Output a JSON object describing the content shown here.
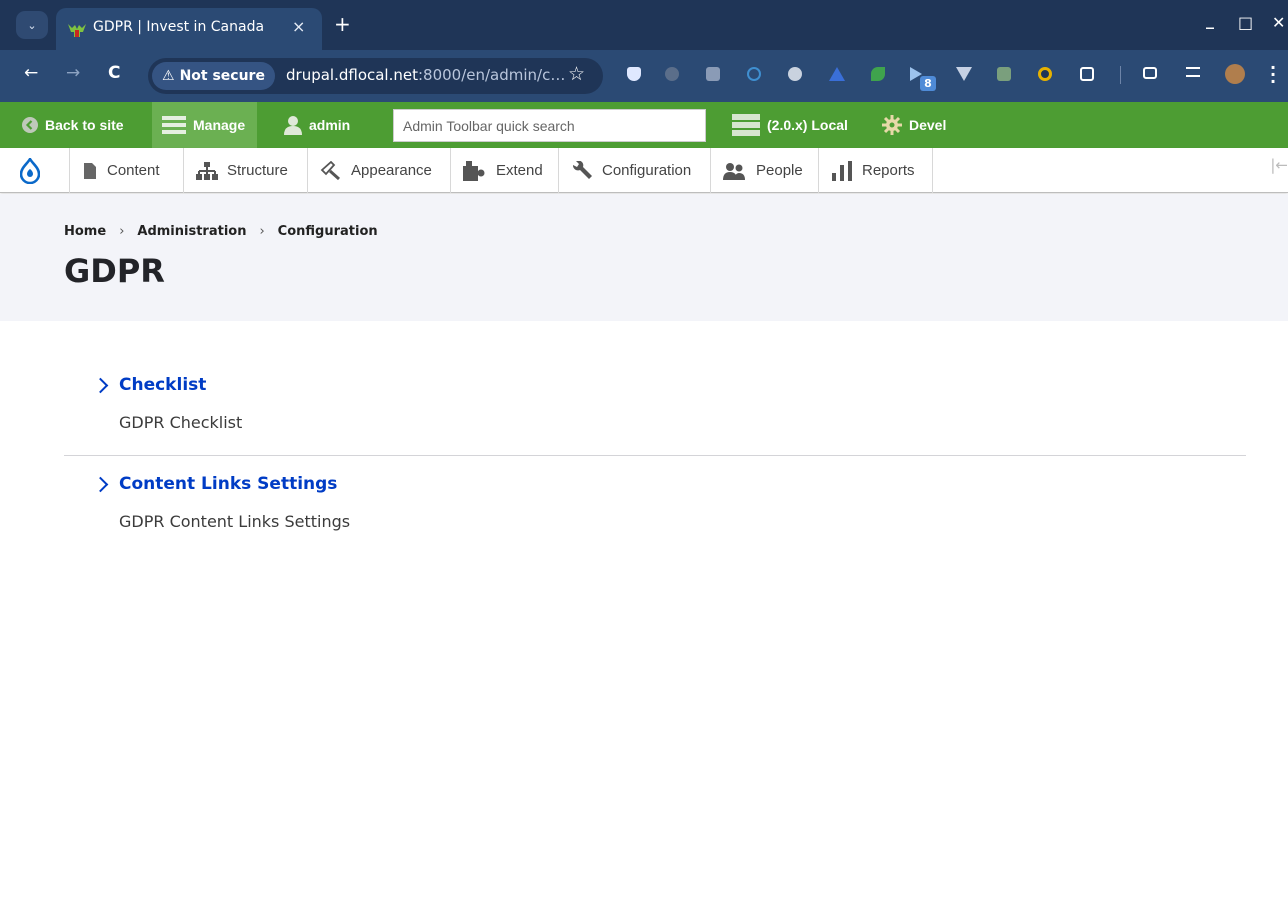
{
  "browser": {
    "tab_title": "GDPR | Invest in Canada",
    "tab_close": "×",
    "new_tab": "+",
    "tab_list": "⌄",
    "window_controls": {
      "minimize": "_",
      "maximize": "□",
      "close": "✕"
    },
    "nav": {
      "back": "←",
      "forward": "→",
      "reload": "C"
    },
    "security_label": "Not secure",
    "security_icon": "⚠",
    "url_host": "drupal.dflocal.net",
    "url_rest": ":8000/en/admin/c…",
    "bookmark_icon": "☆",
    "extension_badge": "8",
    "extension_icon_names": [
      "shield-icon",
      "gear-icon",
      "camera-icon",
      "c-icon",
      "u-icon",
      "triangle-icon",
      "leaf-icon",
      "play-icon",
      "v-icon",
      "layers-icon",
      "circle-icon",
      "puzzle-icon",
      "cast-icon",
      "queue-icon",
      "profile-icon",
      "menu-icon"
    ]
  },
  "admin_toolbar": {
    "back_to_site": "Back to site",
    "manage": "Manage",
    "user": "admin",
    "search_placeholder": "Admin Toolbar quick search",
    "environment": "(2.0.x) Local",
    "devel": "Devel",
    "color": "#4d9d33"
  },
  "tray": {
    "items": [
      {
        "label": "Content",
        "icon": "document-icon"
      },
      {
        "label": "Structure",
        "icon": "sitemap-icon"
      },
      {
        "label": "Appearance",
        "icon": "paintbrush-icon"
      },
      {
        "label": "Extend",
        "icon": "puzzle-icon"
      },
      {
        "label": "Configuration",
        "icon": "wrench-icon"
      },
      {
        "label": "People",
        "icon": "people-icon"
      },
      {
        "label": "Reports",
        "icon": "bar-chart-icon"
      }
    ],
    "collapse": "|←"
  },
  "page": {
    "breadcrumb": [
      "Home",
      "Administration",
      "Configuration"
    ],
    "breadcrumb_separator": "›",
    "title": "GDPR"
  },
  "admin_list": [
    {
      "title": "Checklist",
      "description": "GDPR Checklist"
    },
    {
      "title": "Content Links Settings",
      "description": "GDPR Content Links Settings"
    }
  ],
  "colors": {
    "link": "#003cc5",
    "title_bar": "#1f3557",
    "nav_bar": "#2b4a74"
  }
}
